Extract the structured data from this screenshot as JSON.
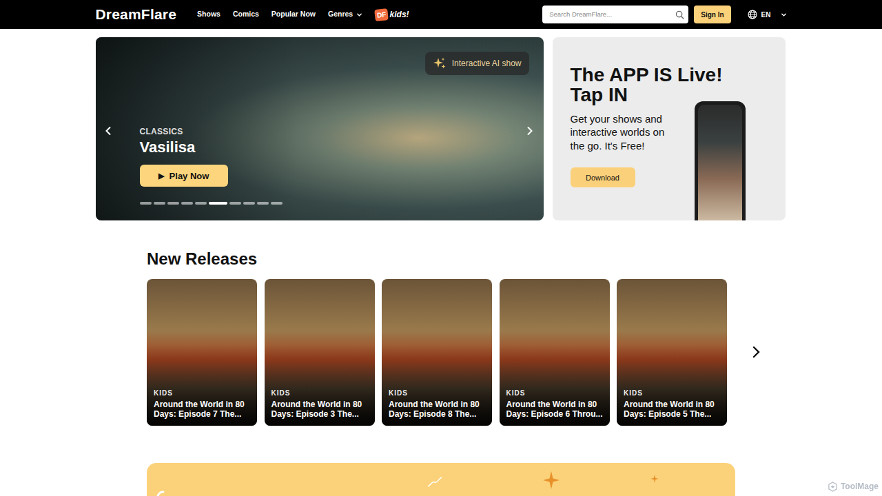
{
  "nav": {
    "logo": "DreamFlare",
    "links": [
      {
        "label": "Shows"
      },
      {
        "label": "Comics"
      },
      {
        "label": "Popular Now"
      },
      {
        "label": "Genres"
      }
    ],
    "kids_logo": {
      "mark": "DF",
      "text": "kids!"
    },
    "search": {
      "placeholder": "Search DreamFlare..."
    },
    "sign_in": "Sign In",
    "language": "EN"
  },
  "hero": {
    "badge": "Interactive AI show",
    "category": "CLASSICS",
    "title": "Vasilisa",
    "play_icon": "▶",
    "button": "Play Now",
    "dots": [
      {
        "selected": false
      },
      {
        "selected": false
      },
      {
        "selected": false
      },
      {
        "selected": false
      },
      {
        "selected": false
      },
      {
        "selected": true
      },
      {
        "selected": false
      },
      {
        "selected": false
      },
      {
        "selected": false
      },
      {
        "selected": false
      }
    ]
  },
  "promo": {
    "title_line1": "The APP IS Live!",
    "title_line2": "Tap IN",
    "text": "Get your shows and interactive worlds on the go. It's Free!",
    "button": "Download"
  },
  "new_releases": {
    "title": "New Releases",
    "items": [
      {
        "category": "KIDS",
        "title": "Around the World in 80 Days: Episode 7 The..."
      },
      {
        "category": "KIDS",
        "title": "Around the World in 80 Days: Episode 3 The..."
      },
      {
        "category": "KIDS",
        "title": "Around the World in 80 Days: Episode 8 The..."
      },
      {
        "category": "KIDS",
        "title": "Around the World in 80 Days: Episode 6 Throu..."
      },
      {
        "category": "KIDS",
        "title": "Around the World in 80 Days: Episode 5 The..."
      }
    ]
  },
  "watermark": "ToolMage"
}
